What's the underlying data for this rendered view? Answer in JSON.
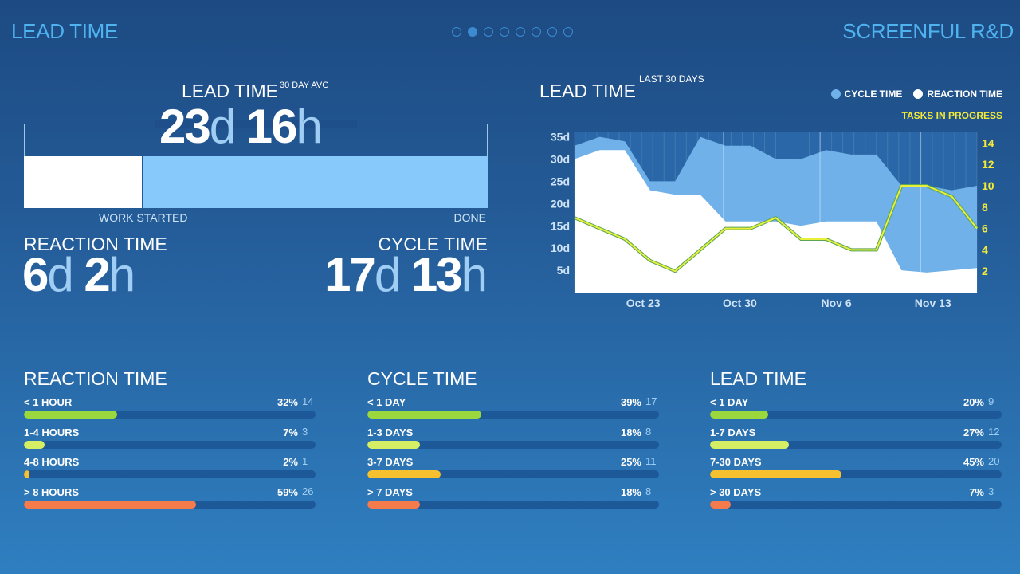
{
  "header": {
    "title": "LEAD TIME",
    "brand": "SCREENFUL R&D",
    "pages": 8,
    "active_page": 1
  },
  "summary": {
    "lead_time": {
      "label": "LEAD TIME",
      "sub": "30 DAY AVG",
      "days": "23",
      "hours": "16",
      "d": "d",
      "h": "h"
    },
    "bar_start_label": "WORK STARTED",
    "bar_end_label": "DONE",
    "reaction_share": 0.255,
    "reaction_time": {
      "label": "REACTION TIME",
      "days": "6",
      "hours": "2",
      "d": "d",
      "h": "h"
    },
    "cycle_time": {
      "label": "CYCLE TIME",
      "days": "17",
      "hours": "13",
      "d": "d",
      "h": "h"
    }
  },
  "chart_header": {
    "title": "LEAD TIME",
    "sub": "LAST 30 DAYS",
    "legend": [
      {
        "label": "CYCLE TIME",
        "color": "#6fb1e8"
      },
      {
        "label": "REACTION TIME",
        "color": "#ffffff"
      }
    ],
    "tasks_label": "TASKS IN PROGRESS"
  },
  "chart_data": {
    "type": "area",
    "x": [
      "Oct 17",
      "Oct 19",
      "Oct 21",
      "Oct 22",
      "Oct 24",
      "Oct 26",
      "Oct 27",
      "Oct 29",
      "Oct 31",
      "Nov 2",
      "Nov 4",
      "Nov 6",
      "Nov 8",
      "Nov 10",
      "Nov 12",
      "Nov 14",
      "Nov 16"
    ],
    "x_ticks": [
      "Oct 23",
      "Oct 30",
      "Nov 6",
      "Nov 13"
    ],
    "y_ticks": [
      "5d",
      "10d",
      "15d",
      "20d",
      "25d",
      "30d",
      "35d"
    ],
    "y2_ticks": [
      "2",
      "4",
      "6",
      "8",
      "10",
      "12",
      "14"
    ],
    "ylim": [
      0,
      36
    ],
    "y2lim": [
      0,
      15
    ],
    "series": [
      {
        "name": "REACTION TIME",
        "values": [
          30,
          32,
          32,
          23,
          22,
          22,
          16,
          16,
          16,
          15,
          16,
          16,
          16,
          5,
          4.5,
          5,
          5.5
        ]
      },
      {
        "name": "CYCLE TIME",
        "values": [
          33,
          35,
          34,
          25,
          25,
          35,
          33,
          33,
          30,
          30,
          32,
          31,
          31,
          24,
          24,
          23,
          24
        ]
      },
      {
        "name": "TASKS IN PROGRESS",
        "axis": "right",
        "values": [
          7,
          6,
          5,
          3,
          2,
          4,
          6,
          6,
          7,
          5,
          5,
          4,
          4,
          10,
          10,
          9,
          6
        ]
      }
    ],
    "grid": true
  },
  "panels": [
    {
      "title": "REACTION TIME",
      "rows": [
        {
          "label": "< 1 HOUR",
          "pct": "32%",
          "count": "14",
          "value": 0.32,
          "color": "#9bd83d"
        },
        {
          "label": "1-4 HOURS",
          "pct": "7%",
          "count": "3",
          "value": 0.07,
          "color": "#d6ee63"
        },
        {
          "label": "4-8 HOURS",
          "pct": "2%",
          "count": "1",
          "value": 0.02,
          "color": "#f6c02e"
        },
        {
          "label": "> 8 HOURS",
          "pct": "59%",
          "count": "26",
          "value": 0.59,
          "color": "#f47b4c"
        }
      ]
    },
    {
      "title": "CYCLE TIME",
      "rows": [
        {
          "label": "< 1 DAY",
          "pct": "39%",
          "count": "17",
          "value": 0.39,
          "color": "#9bd83d"
        },
        {
          "label": "1-3 DAYS",
          "pct": "18%",
          "count": "8",
          "value": 0.18,
          "color": "#d6ee63"
        },
        {
          "label": "3-7 DAYS",
          "pct": "25%",
          "count": "11",
          "value": 0.25,
          "color": "#f6c02e"
        },
        {
          "label": "> 7 DAYS",
          "pct": "18%",
          "count": "8",
          "value": 0.18,
          "color": "#f47b4c"
        }
      ]
    },
    {
      "title": "LEAD TIME",
      "rows": [
        {
          "label": "< 1 DAY",
          "pct": "20%",
          "count": "9",
          "value": 0.2,
          "color": "#9bd83d"
        },
        {
          "label": "1-7 DAYS",
          "pct": "27%",
          "count": "12",
          "value": 0.27,
          "color": "#d6ee63"
        },
        {
          "label": "7-30 DAYS",
          "pct": "45%",
          "count": "20",
          "value": 0.45,
          "color": "#f6c02e"
        },
        {
          "label": "> 30 DAYS",
          "pct": "7%",
          "count": "3",
          "value": 0.07,
          "color": "#f47b4c"
        }
      ]
    }
  ]
}
